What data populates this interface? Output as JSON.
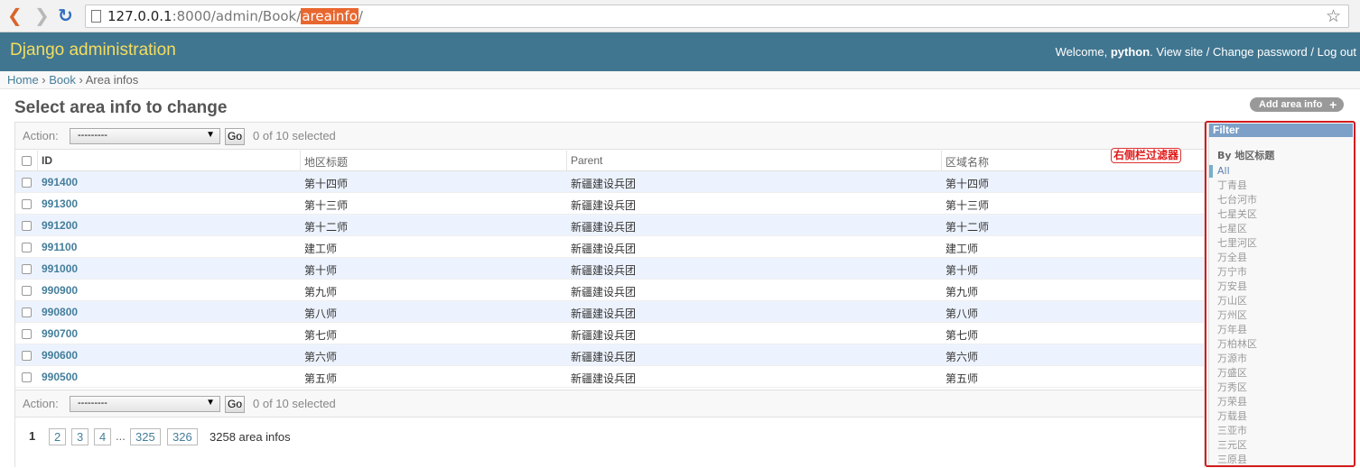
{
  "browser": {
    "url_host": "127.0.0.1",
    "url_rest": ":8000/admin/Book/",
    "url_highlight": "areainfo",
    "url_tail": "/"
  },
  "header": {
    "brand": "Django administration",
    "welcome": "Welcome,",
    "username": "python",
    "links": ". View site / Change password / Log out"
  },
  "breadcrumb": {
    "home": "Home",
    "sep": " › ",
    "app": "Book",
    "current": "Area infos"
  },
  "page": {
    "title": "Select area info to change",
    "add_button": "Add area info"
  },
  "actions": {
    "label": "Action:",
    "selected_value": "---------",
    "go": "Go",
    "selected_count": "0 of 10 selected"
  },
  "table": {
    "headers": [
      "ID",
      "地区标题",
      "Parent",
      "区域名称"
    ],
    "rows": [
      {
        "id": "991400",
        "title": "第十四师",
        "parent": "新疆建设兵团",
        "name": "第十四师"
      },
      {
        "id": "991300",
        "title": "第十三师",
        "parent": "新疆建设兵团",
        "name": "第十三师"
      },
      {
        "id": "991200",
        "title": "第十二师",
        "parent": "新疆建设兵团",
        "name": "第十二师"
      },
      {
        "id": "991100",
        "title": "建工师",
        "parent": "新疆建设兵团",
        "name": "建工师"
      },
      {
        "id": "991000",
        "title": "第十师",
        "parent": "新疆建设兵团",
        "name": "第十师"
      },
      {
        "id": "990900",
        "title": "第九师",
        "parent": "新疆建设兵团",
        "name": "第九师"
      },
      {
        "id": "990800",
        "title": "第八师",
        "parent": "新疆建设兵团",
        "name": "第八师"
      },
      {
        "id": "990700",
        "title": "第七师",
        "parent": "新疆建设兵团",
        "name": "第七师"
      },
      {
        "id": "990600",
        "title": "第六师",
        "parent": "新疆建设兵团",
        "name": "第六师"
      },
      {
        "id": "990500",
        "title": "第五师",
        "parent": "新疆建设兵团",
        "name": "第五师"
      }
    ]
  },
  "paginator": {
    "current": "1",
    "pages": [
      "2",
      "3",
      "4"
    ],
    "ellipsis": "...",
    "tail_pages": [
      "325",
      "326"
    ],
    "total": "3258 area infos"
  },
  "annotation": "右侧栏过滤器",
  "filter": {
    "title": "Filter",
    "by": "By 地区标题",
    "selected": "All",
    "items": [
      "丁青县",
      "七台河市",
      "七星关区",
      "七星区",
      "七里河区",
      "万全县",
      "万宁市",
      "万安县",
      "万山区",
      "万州区",
      "万年县",
      "万柏林区",
      "万源市",
      "万盛区",
      "万秀区",
      "万荣县",
      "万载县",
      "三亚市",
      "三元区",
      "三原县"
    ]
  },
  "colors": {
    "header_bg": "#417690",
    "brand": "#f5dd5d",
    "link": "#447e9b",
    "callout": "#e01818"
  }
}
